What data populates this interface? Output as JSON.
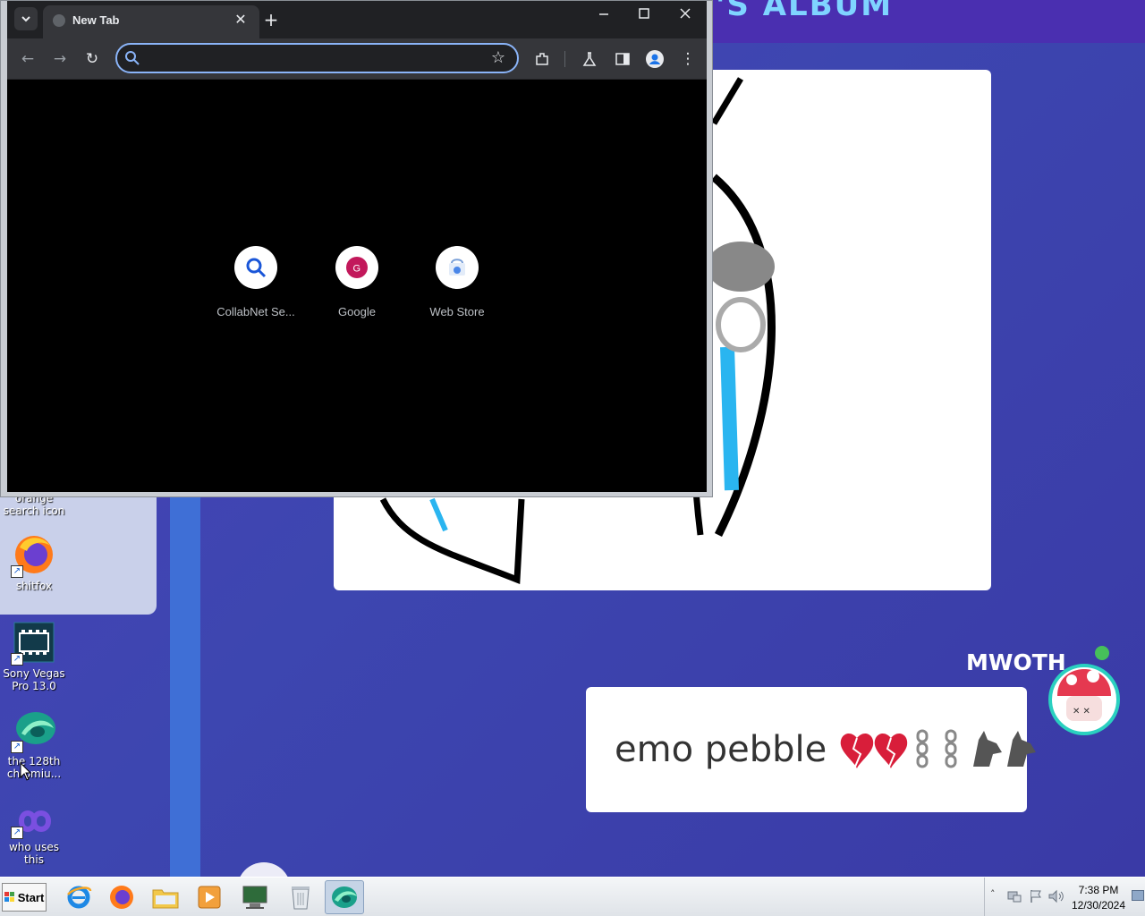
{
  "browser": {
    "tab_title": "New Tab",
    "omnibox_placeholder": "",
    "shortcuts": [
      {
        "label": "CollabNet Se...",
        "icon": "magnifier-icon"
      },
      {
        "label": "Google",
        "icon": "google-g-icon"
      },
      {
        "label": "Web Store",
        "icon": "web-store-icon"
      }
    ]
  },
  "desktop": {
    "icons": [
      {
        "label": "orange search icon",
        "icon": "orange-search-icon"
      },
      {
        "label": "shitfox",
        "icon": "firefox-icon"
      },
      {
        "label": "Sony Vegas Pro 13.0",
        "icon": "film-icon"
      },
      {
        "label": "the 128th chromiu...",
        "icon": "chromium-icon"
      },
      {
        "label": "who uses this",
        "icon": "infinity-icon"
      }
    ]
  },
  "wallpaper": {
    "top_text": "'S ALBUM",
    "name_label": "MWOTH",
    "bubble_text": "emo pebble",
    "bubble_emoji": "💔💔⛓⛓🐺🐺"
  },
  "taskbar": {
    "start_label": "Start",
    "apps": [
      "internet-explorer-icon",
      "firefox-icon",
      "folder-icon",
      "media-player-icon",
      "computer-monitor-icon",
      "recycle-bin-icon",
      "chromium-icon"
    ],
    "clock_time": "7:38 PM",
    "clock_date": "12/30/2024"
  },
  "colors": {
    "chrome_dark": "#202124",
    "chrome_toolbar": "#35363a",
    "omnibox_focus": "#8ab4f8",
    "wallpaper_blue": "#3d46b0"
  }
}
